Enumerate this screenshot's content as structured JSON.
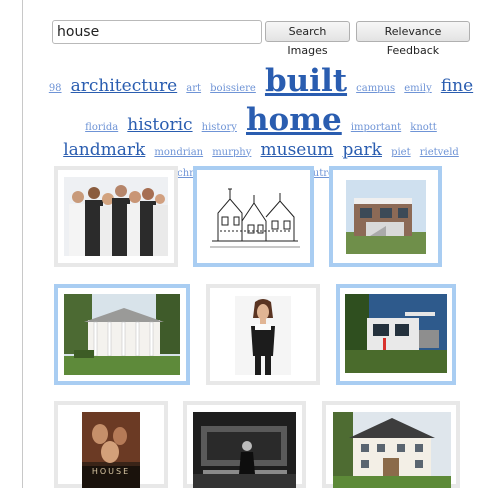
{
  "search": {
    "value": "house",
    "placeholder": ""
  },
  "buttons": {
    "search_label": "Search Images",
    "feedback_label": "Relevance Feedback"
  },
  "tags": [
    {
      "text": "98",
      "size": 1
    },
    {
      "text": "architecture",
      "size": 3
    },
    {
      "text": "art",
      "size": 1
    },
    {
      "text": "boissiere",
      "size": 1
    },
    {
      "text": "built",
      "size": 5
    },
    {
      "text": "campus",
      "size": 1
    },
    {
      "text": "emily",
      "size": 1
    },
    {
      "text": "fine",
      "size": 3
    },
    {
      "text": "florida",
      "size": 1
    },
    {
      "text": "historic",
      "size": 3
    },
    {
      "text": "history",
      "size": 1
    },
    {
      "text": "home",
      "size": 5
    },
    {
      "text": "important",
      "size": 1
    },
    {
      "text": "knott",
      "size": 1
    },
    {
      "text": "landmark",
      "size": 3
    },
    {
      "text": "mondrian",
      "size": 1
    },
    {
      "text": "murphy",
      "size": 1
    },
    {
      "text": "museum",
      "size": 3
    },
    {
      "text": "park",
      "size": 3
    },
    {
      "text": "piet",
      "size": 1
    },
    {
      "text": "rietveld",
      "size": 1
    },
    {
      "text": "schräder",
      "size": 1
    },
    {
      "text": "schröder",
      "size": 1
    },
    {
      "text": "sites",
      "size": 1
    },
    {
      "text": "utrecht",
      "size": 1
    }
  ],
  "results": [
    {
      "name": "tv-cast-group-photo",
      "selected": false
    },
    {
      "name": "victorian-house-drawing",
      "selected": true
    },
    {
      "name": "modern-house-photo",
      "selected": true
    },
    {
      "name": "colonial-house-photo",
      "selected": true
    },
    {
      "name": "woman-portrait-photo",
      "selected": false
    },
    {
      "name": "rietveld-house-photo",
      "selected": true
    },
    {
      "name": "house-tv-poster",
      "selected": false
    },
    {
      "name": "man-on-bench-photo",
      "selected": false
    },
    {
      "name": "large-white-house-photo",
      "selected": false
    }
  ],
  "poster_title": "HOUSE",
  "colors": {
    "selected_border": "#a9cdf2",
    "unselected_border": "#e8e8e8",
    "tag_link": "#2a5db0"
  }
}
